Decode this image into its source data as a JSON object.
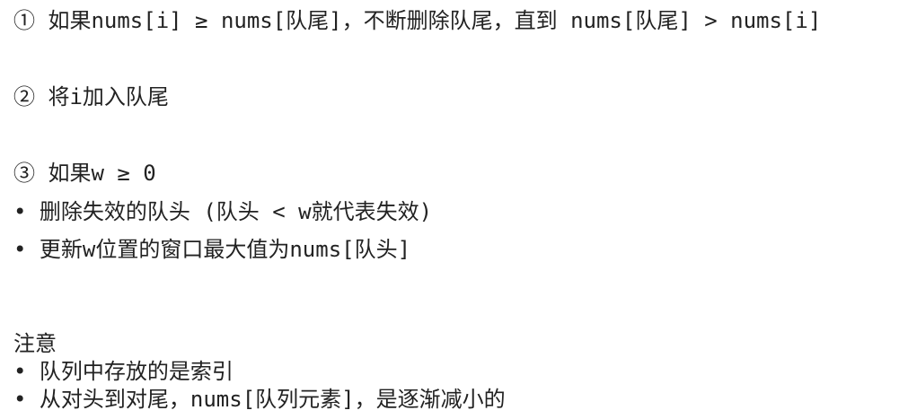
{
  "lines": [
    "① 如果nums[i] ≥ nums[队尾]，不断删除队尾，直到 nums[队尾] > nums[i]",
    "② 将i加入队尾",
    "③ 如果w ≥ 0",
    "• 删除失效的队头 (队头 < w就代表失效)",
    "• 更新w位置的窗口最大值为nums[队头]",
    "注意",
    "•  队列中存放的是索引",
    "•  从对头到对尾，nums[队列元素]，是逐渐减小的"
  ]
}
